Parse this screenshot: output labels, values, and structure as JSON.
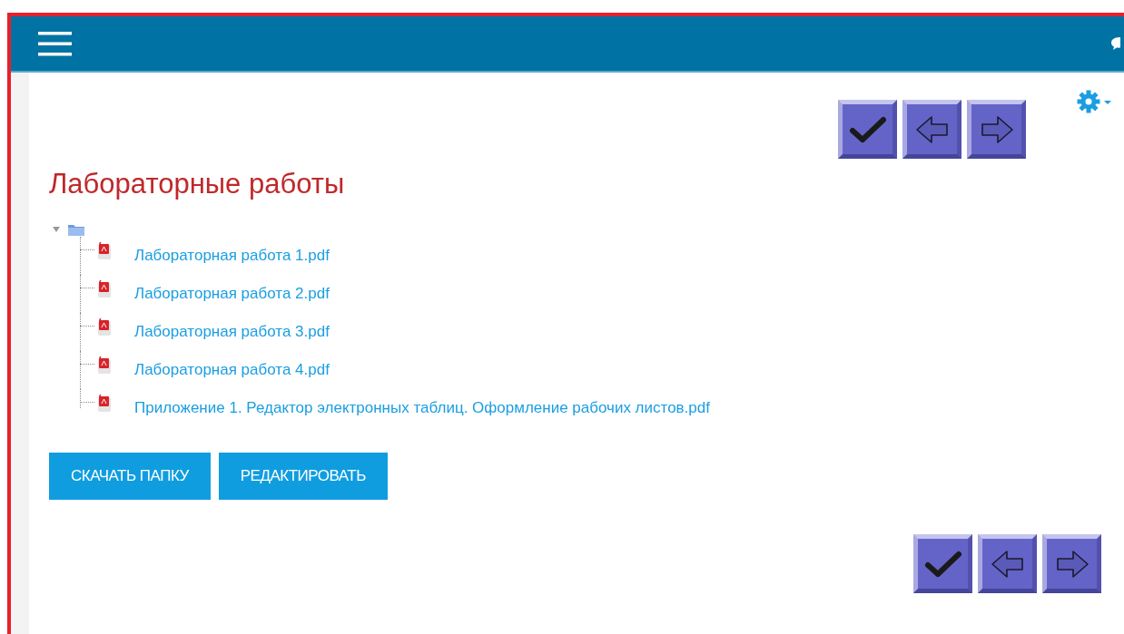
{
  "title": "Лабораторные работы",
  "folder": {
    "expanded": true,
    "files": [
      {
        "name": "Лабораторная работа 1.pdf"
      },
      {
        "name": "Лабораторная работа 2.pdf"
      },
      {
        "name": "Лабораторная работа 3.pdf"
      },
      {
        "name": "Лабораторная работа 4.pdf"
      },
      {
        "name": "Приложение 1. Редактор электронных таблиц. Оформление рабочих листов.pdf"
      }
    ]
  },
  "buttons": [
    "СКАЧАТЬ ПАПКУ",
    "РЕДАКТИРОВАТЬ"
  ]
}
